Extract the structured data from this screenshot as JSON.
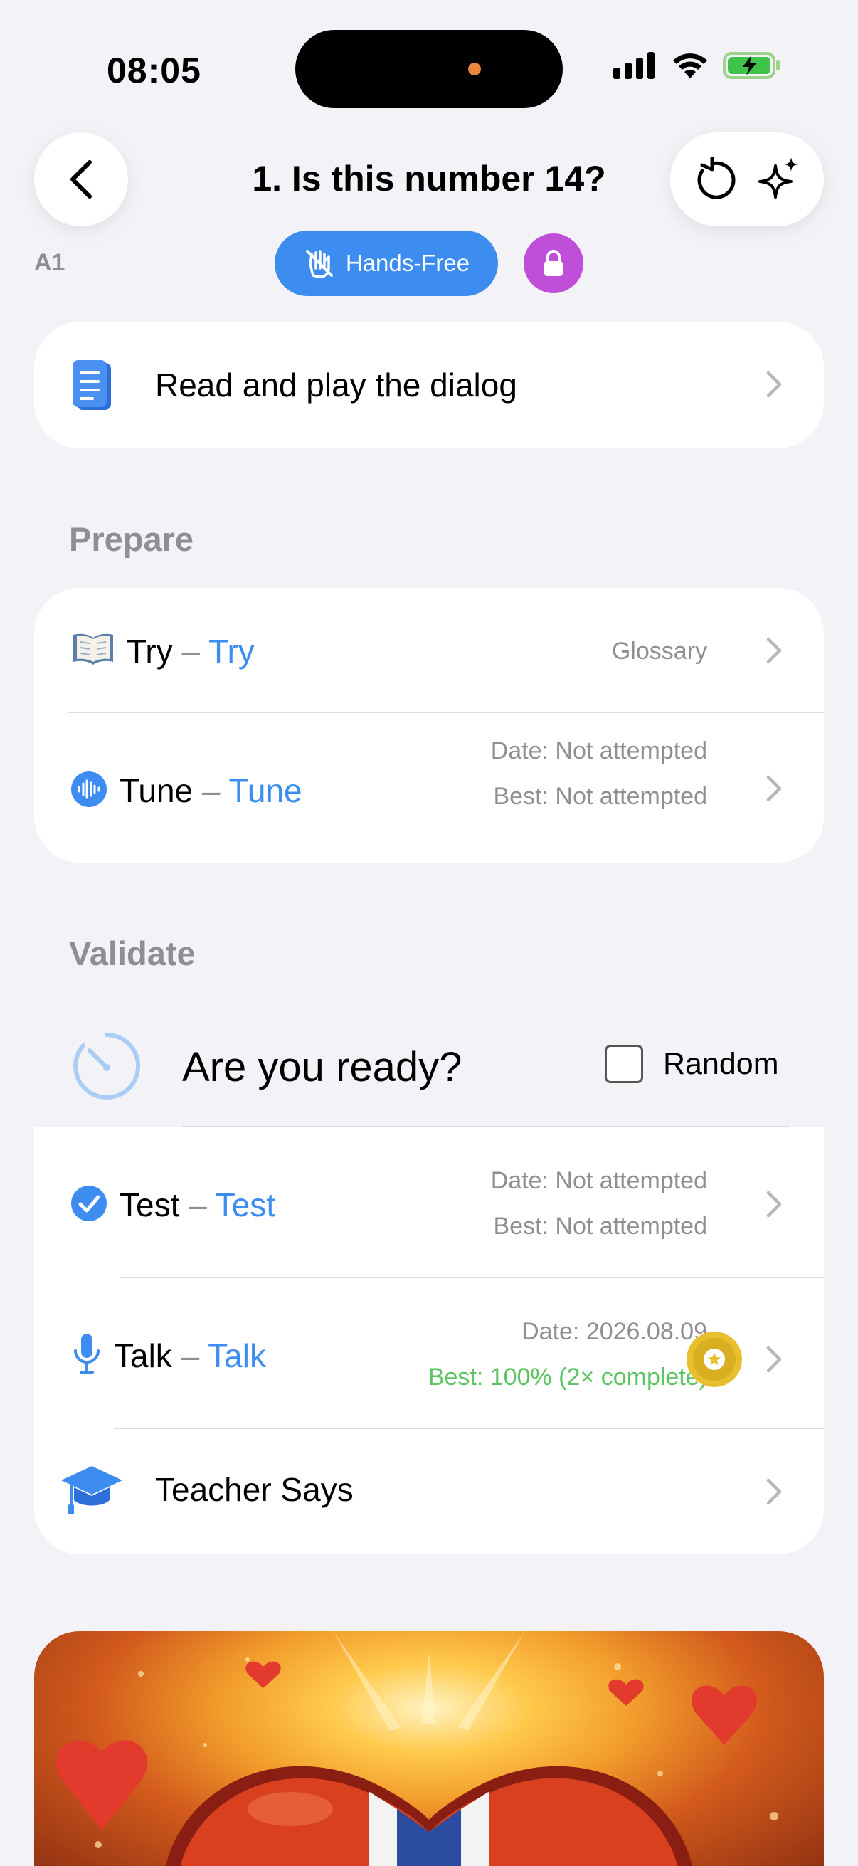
{
  "status_bar": {
    "time": "08:05"
  },
  "header": {
    "title": "1. Is this number 14?",
    "level": "A1",
    "hands_free_label": "Hands-Free"
  },
  "dialog_row": {
    "label": "Read and play the dialog"
  },
  "prepare": {
    "section_title": "Prepare",
    "try": {
      "name": "Try",
      "translation": "Try",
      "meta": "Glossary"
    },
    "tune": {
      "name": "Tune",
      "translation": "Tune",
      "date": "Date: Not attempted",
      "best": "Best: Not attempted"
    }
  },
  "validate": {
    "section_title": "Validate",
    "ready_title": "Are you ready?",
    "random_label": "Random",
    "random_checked": false,
    "test": {
      "name": "Test",
      "translation": "Test",
      "date": "Date: Not attempted",
      "best": "Best: Not attempted"
    },
    "talk": {
      "name": "Talk",
      "translation": "Talk",
      "date": "Date: 2026.08.09",
      "best": "Best: 100% (2× complete)"
    },
    "teacher": {
      "label": "Teacher Says"
    }
  },
  "colors": {
    "accent_blue": "#3D8DF0",
    "lock_purple": "#BF4FD8",
    "success_green": "#5CC460",
    "medal_gold": "#E8C02E"
  },
  "separator": "–"
}
